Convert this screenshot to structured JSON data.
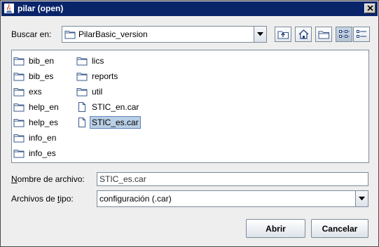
{
  "window": {
    "title": "pilar (open)",
    "title_bar_color": "#0a246a"
  },
  "look_in": {
    "label": "Buscar en:",
    "value": "PilarBasic_version",
    "icon": "folder-icon"
  },
  "toolbar": {
    "buttons": [
      {
        "icon": "up-one-level-icon"
      },
      {
        "icon": "home-icon"
      },
      {
        "icon": "new-folder-icon"
      },
      {
        "icon": "list-view-icon",
        "pressed": true
      },
      {
        "icon": "details-view-icon"
      }
    ]
  },
  "files": {
    "col1": [
      {
        "name": "bib_en",
        "type": "folder"
      },
      {
        "name": "bib_es",
        "type": "folder"
      },
      {
        "name": "exs",
        "type": "folder"
      },
      {
        "name": "help_en",
        "type": "folder"
      },
      {
        "name": "help_es",
        "type": "folder"
      },
      {
        "name": "info_en",
        "type": "folder"
      },
      {
        "name": "info_es",
        "type": "folder"
      }
    ],
    "col2": [
      {
        "name": "lics",
        "type": "folder"
      },
      {
        "name": "reports",
        "type": "folder"
      },
      {
        "name": "util",
        "type": "folder"
      },
      {
        "name": "STIC_en.car",
        "type": "file"
      },
      {
        "name": "STIC_es.car",
        "type": "file",
        "selected": true
      }
    ],
    "selection_color": "#b8cfe5"
  },
  "file_name": {
    "label": "Nombre de archivo:",
    "value": "STIC_es.car"
  },
  "file_type": {
    "label": "Archivos de tipo:",
    "value": "configuración (.car)"
  },
  "actions": {
    "open_label": "Abrir",
    "cancel_label": "Cancelar"
  }
}
